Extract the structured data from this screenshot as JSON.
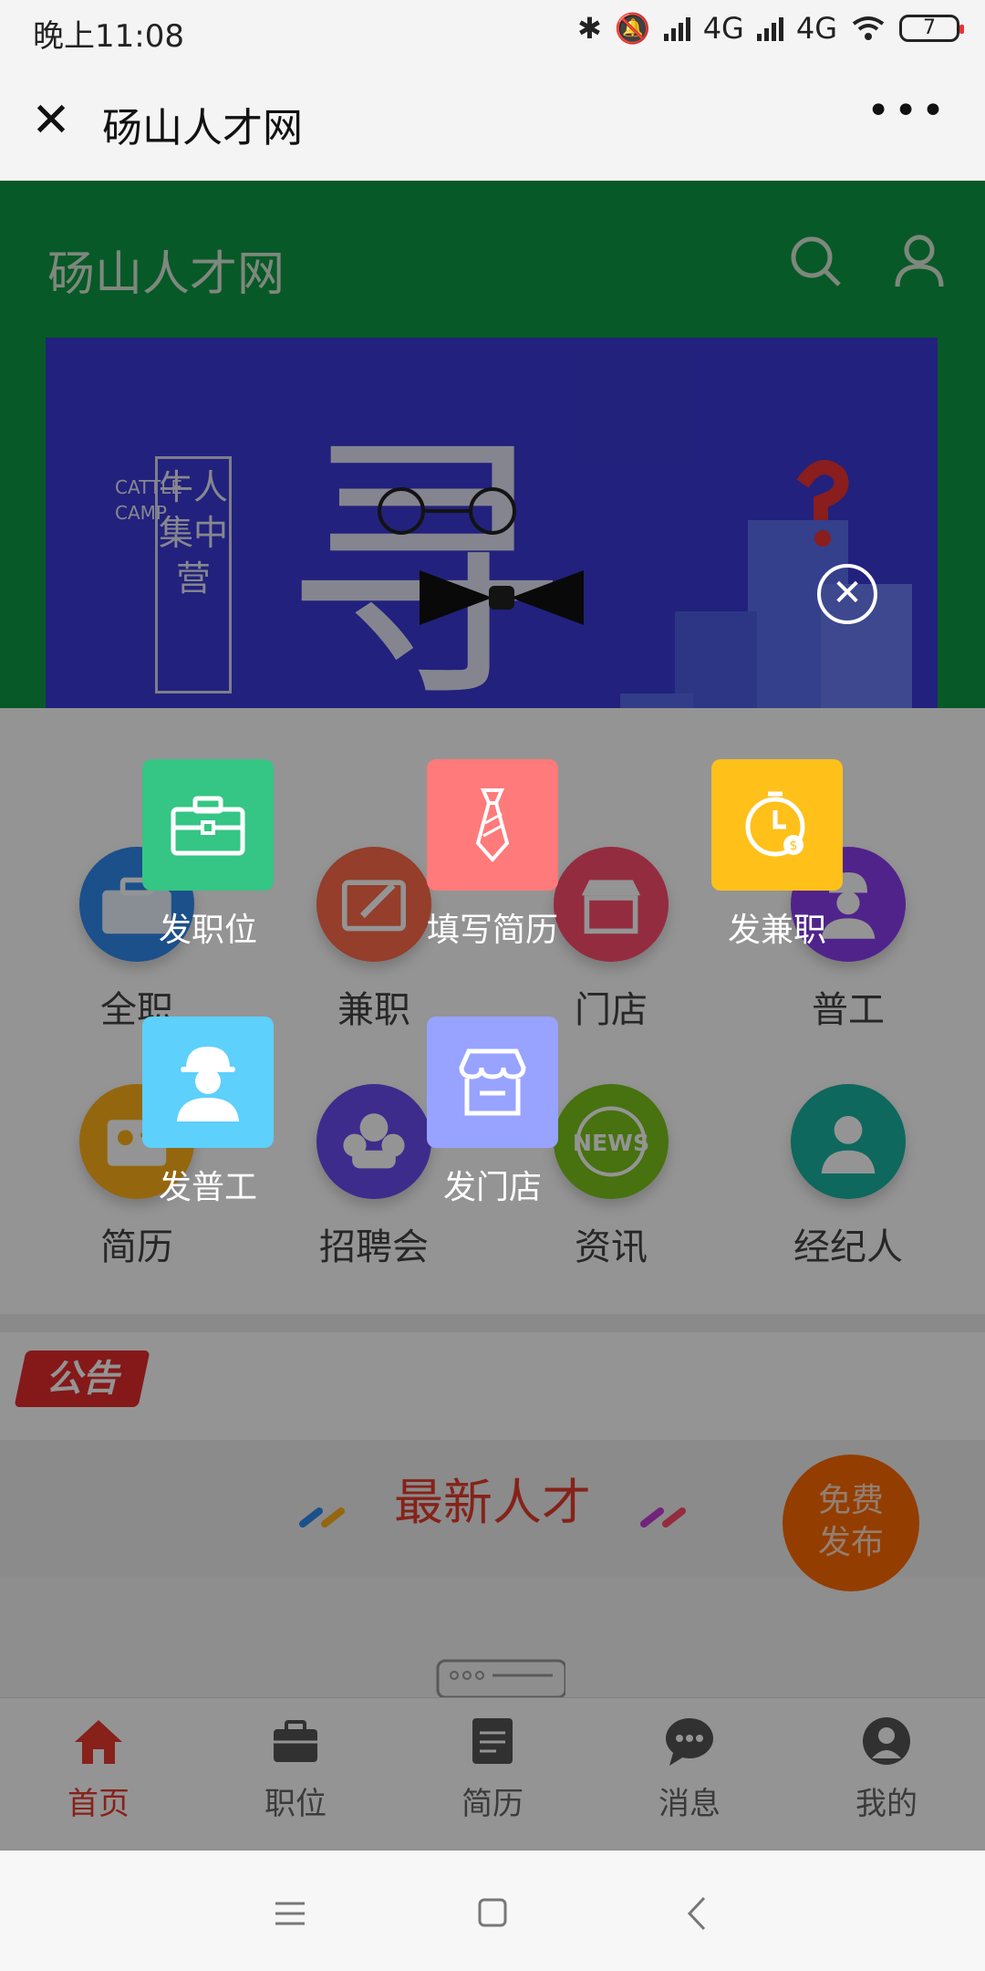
{
  "status_bar": {
    "time": "晚上11:08",
    "network_1": "4G",
    "network_2": "4G",
    "battery": "7"
  },
  "wechat_bar": {
    "close_glyph": "✕",
    "title": "砀山人才网",
    "more_glyph": "•••"
  },
  "site": {
    "title": "砀山人才网"
  },
  "banner": {
    "vertical_text": "牛人集中营",
    "english_text": "CATTLE CAMP",
    "big_char": "寻"
  },
  "categories": [
    {
      "label": "全职",
      "icon": "briefcase-icon",
      "color": "#2f8bef"
    },
    {
      "label": "兼职",
      "icon": "edit-icon",
      "color": "#ff6b4a"
    },
    {
      "label": "门店",
      "icon": "store-icon",
      "color": "#ff4d6d"
    },
    {
      "label": "普工",
      "icon": "worker-icon",
      "color": "#8a3df0"
    },
    {
      "label": "简历",
      "icon": "resume-icon",
      "color": "#ffb21a"
    },
    {
      "label": "招聘会",
      "icon": "fair-icon",
      "color": "#6a4cf2"
    },
    {
      "label": "资讯",
      "icon": "news-icon",
      "color": "#7ac41b"
    },
    {
      "label": "经纪人",
      "icon": "agent-icon",
      "color": "#19b3a3"
    }
  ],
  "notice": {
    "badge": "公告"
  },
  "latest": {
    "title": "最新人才"
  },
  "free_publish": {
    "line1": "免费",
    "line2": "发布"
  },
  "tabs": [
    {
      "label": "首页",
      "icon": "home-icon",
      "active": true
    },
    {
      "label": "职位",
      "icon": "briefcase-icon",
      "active": false
    },
    {
      "label": "简历",
      "icon": "resume-icon",
      "active": false
    },
    {
      "label": "消息",
      "icon": "message-icon",
      "active": false
    },
    {
      "label": "我的",
      "icon": "profile-icon",
      "active": false
    }
  ],
  "overlay": {
    "close_glyph": "✕",
    "buttons": [
      {
        "label": "发职位",
        "icon": "briefcase-icon",
        "color": "#35c584"
      },
      {
        "label": "填写简历",
        "icon": "tie-icon",
        "color": "#ff7a7a"
      },
      {
        "label": "发兼职",
        "icon": "clock-icon",
        "color": "#ffc01a"
      },
      {
        "label": "发普工",
        "icon": "worker-icon",
        "color": "#5dd0fb"
      },
      {
        "label": "发门店",
        "icon": "store-icon",
        "color": "#97a3ff"
      }
    ]
  },
  "colors": {
    "header_green": "#0e9a46",
    "accent_red": "#e83a2d",
    "free_orange": "#ff6a00",
    "banner_blue": "#3b3ad8"
  }
}
